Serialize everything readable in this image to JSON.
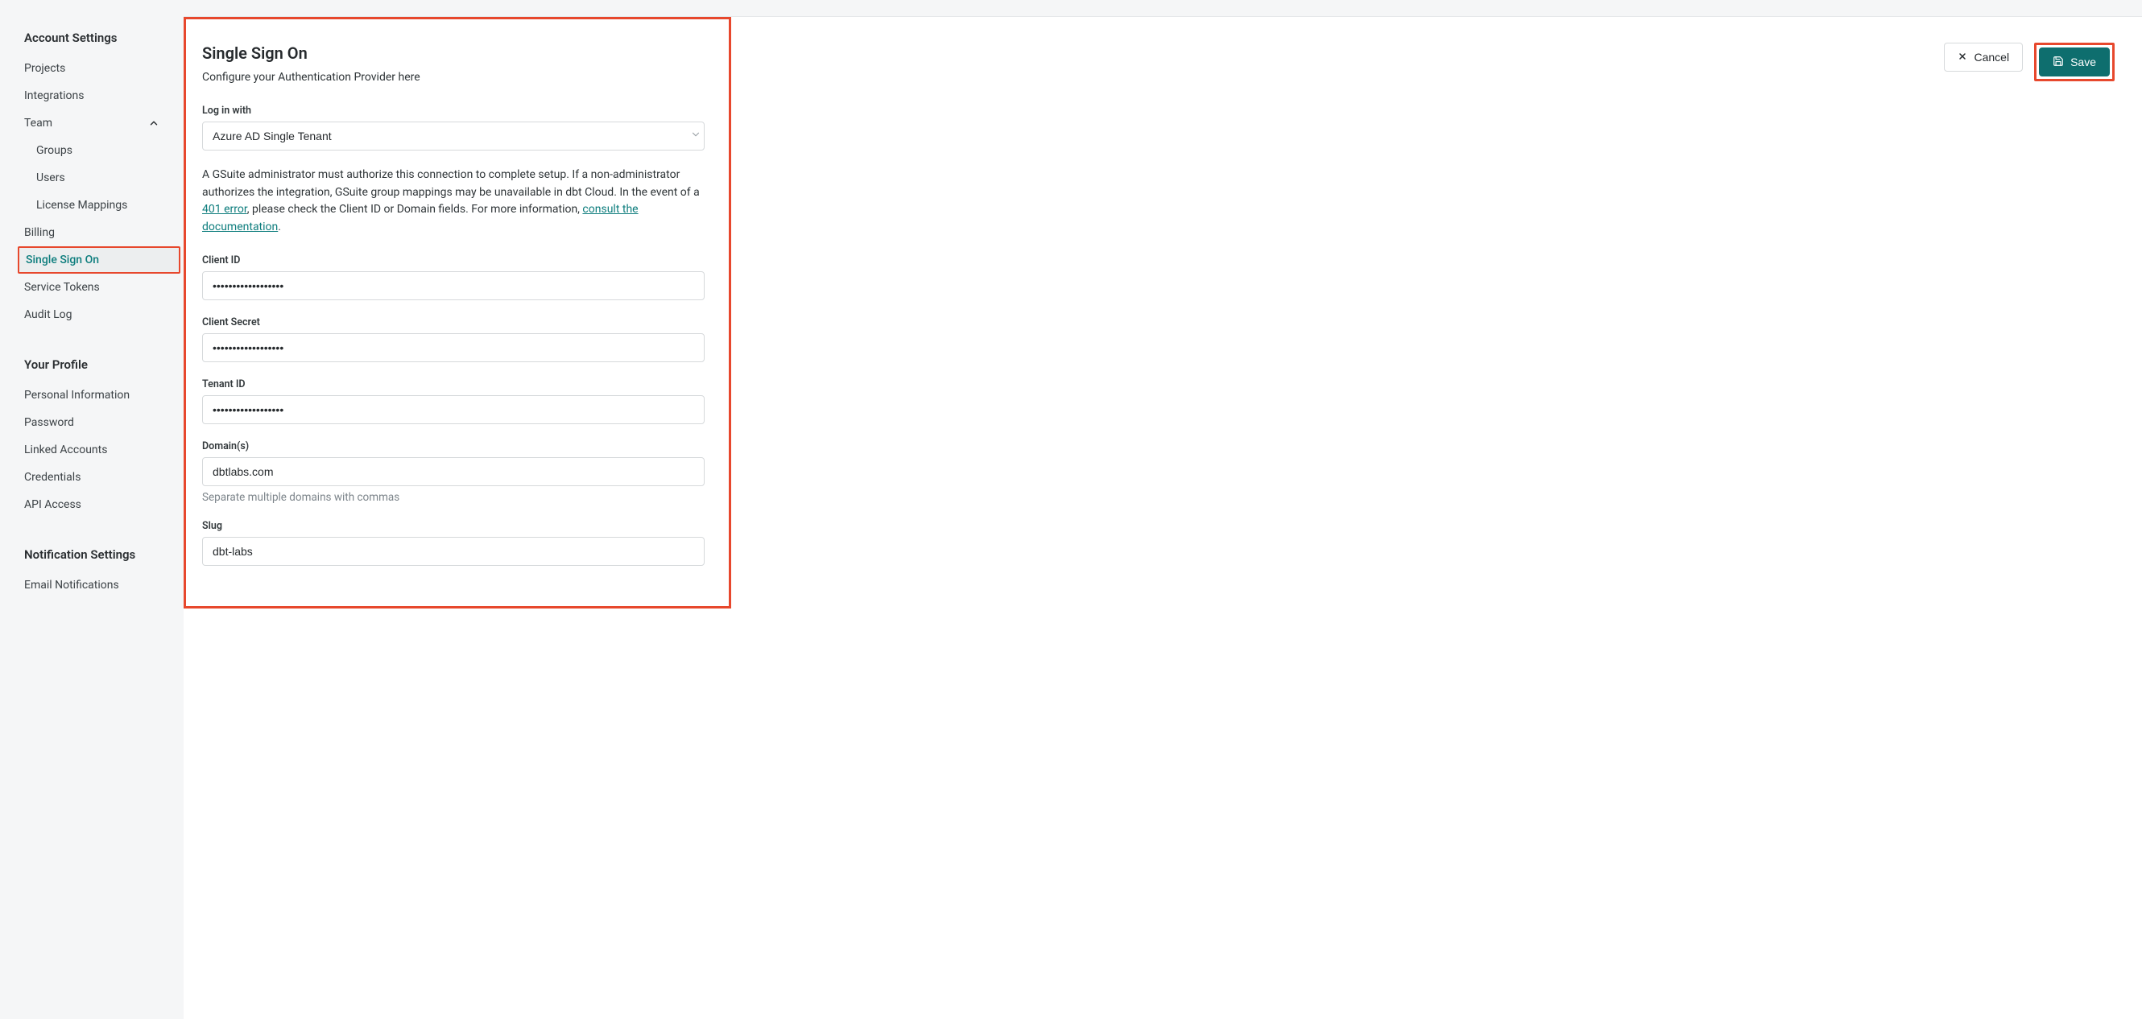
{
  "sidebar": {
    "account_settings_header": "Account Settings",
    "projects": "Projects",
    "integrations": "Integrations",
    "team": "Team",
    "team_children": {
      "groups": "Groups",
      "users": "Users",
      "license_mappings": "License Mappings"
    },
    "billing": "Billing",
    "single_sign_on": "Single Sign On",
    "service_tokens": "Service Tokens",
    "audit_log": "Audit Log",
    "your_profile_header": "Your Profile",
    "personal_information": "Personal Information",
    "password": "Password",
    "linked_accounts": "Linked Accounts",
    "credentials": "Credentials",
    "api_access": "API Access",
    "notification_settings_header": "Notification Settings",
    "email_notifications": "Email Notifications"
  },
  "actions": {
    "cancel_label": "Cancel",
    "save_label": "Save"
  },
  "page": {
    "title": "Single Sign On",
    "subtitle": "Configure your Authentication Provider here"
  },
  "form": {
    "login_with_label": "Log in with",
    "login_with_value": "Azure AD Single Tenant",
    "info_text_1": "A GSuite administrator must authorize this connection to complete setup. If a non-administrator authorizes the integration, GSuite group mappings may be unavailable in dbt Cloud. In the event of a ",
    "info_link_401": "401 error",
    "info_text_2": ", please check the Client ID or Domain fields. For more information, ",
    "info_link_docs": "consult the documentation",
    "info_text_3": ".",
    "client_id_label": "Client ID",
    "client_id_value": "••••••••••••••••••",
    "client_secret_label": "Client Secret",
    "client_secret_value": "••••••••••••••••••",
    "tenant_id_label": "Tenant ID",
    "tenant_id_value": "••••••••••••••••••",
    "domains_label": "Domain(s)",
    "domains_value": "dbtlabs.com",
    "domains_helper": "Separate multiple domains with commas",
    "slug_label": "Slug",
    "slug_value": "dbt-labs"
  },
  "colors": {
    "accent_teal": "#0e6e6e",
    "highlight_red": "#e7482d"
  }
}
